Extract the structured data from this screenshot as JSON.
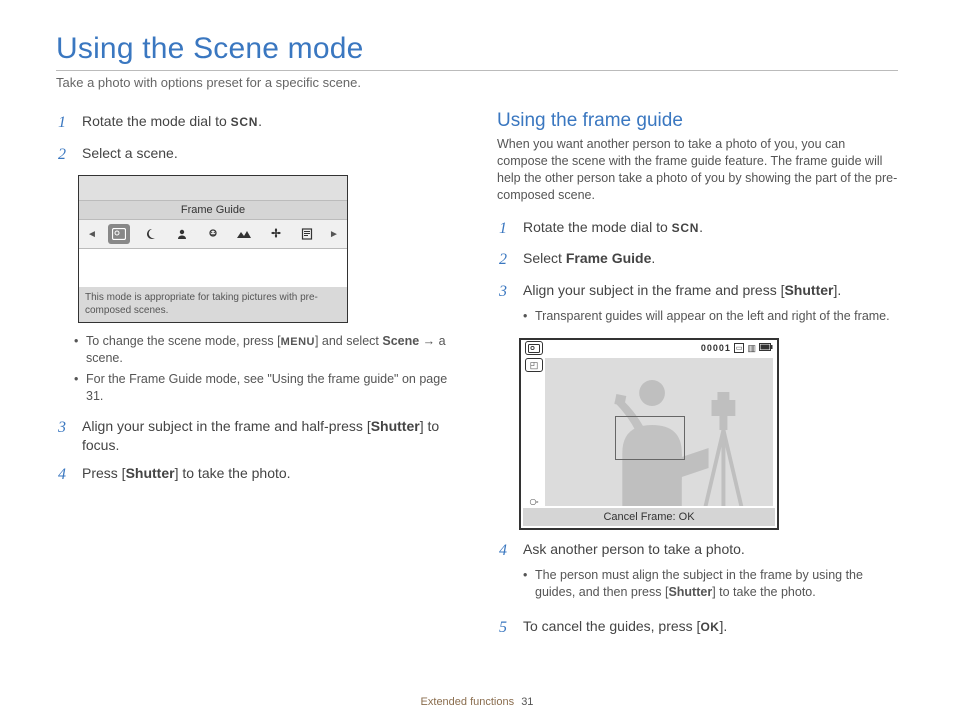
{
  "title": "Using the Scene mode",
  "subtitle": "Take a photo with options preset for a specific scene.",
  "icons": {
    "scn": "SCN",
    "menu": "MENU",
    "ok": "OK"
  },
  "left": {
    "steps": {
      "s1": {
        "num": "1",
        "pre": "Rotate the mode dial to ",
        "post": "."
      },
      "s2": {
        "num": "2",
        "text": "Select a scene."
      },
      "s3": {
        "num": "3",
        "pre": "Align your subject in the frame and half-press [",
        "bold": "Shutter",
        "post": "] to focus."
      },
      "s4": {
        "num": "4",
        "pre": "Press [",
        "bold": "Shutter",
        "post": "] to take the photo."
      }
    },
    "deviceShot": {
      "label": "Frame Guide",
      "desc": "This mode is appropriate for taking pictures with pre-composed scenes.",
      "iconNames": [
        "frame-guide-icon",
        "night-icon",
        "portrait-icon",
        "children-icon",
        "landscape-icon",
        "close-up-icon",
        "text-icon"
      ]
    },
    "bullets": {
      "b1": {
        "pre": "To change the scene mode, press [",
        "mid": "] and select ",
        "bold": "Scene",
        "arrow": " → ",
        "tail": "a scene."
      },
      "b2": "For the Frame Guide mode, see \"Using the frame guide\" on page 31."
    }
  },
  "right": {
    "heading": "Using the frame guide",
    "intro": "When you want another person to take a photo of you, you can compose the scene with the frame guide feature. The frame guide will help the other person take a photo of you by showing the part of the pre-composed scene.",
    "steps": {
      "s1": {
        "num": "1",
        "pre": "Rotate the mode dial to ",
        "post": "."
      },
      "s2": {
        "num": "2",
        "pre": "Select ",
        "bold": "Frame Guide",
        "post": "."
      },
      "s3": {
        "num": "3",
        "pre": "Align your subject in the frame and press [",
        "bold": "Shutter",
        "post": "]."
      },
      "s3b": "Transparent guides will appear on the left and right of the frame.",
      "s4": {
        "num": "4",
        "text": "Ask another person to take a photo."
      },
      "s4b": {
        "pre": "The person must align the subject in the frame by using the guides, and then press [",
        "bold": "Shutter",
        "post": "] to take the photo."
      },
      "s5": {
        "num": "5",
        "pre": "To cancel the guides, press [",
        "post": "]."
      }
    },
    "frameShot": {
      "counter": "00001",
      "bottom": "Cancel Frame: OK"
    }
  },
  "footer": {
    "section": "Extended functions",
    "page": "31"
  }
}
